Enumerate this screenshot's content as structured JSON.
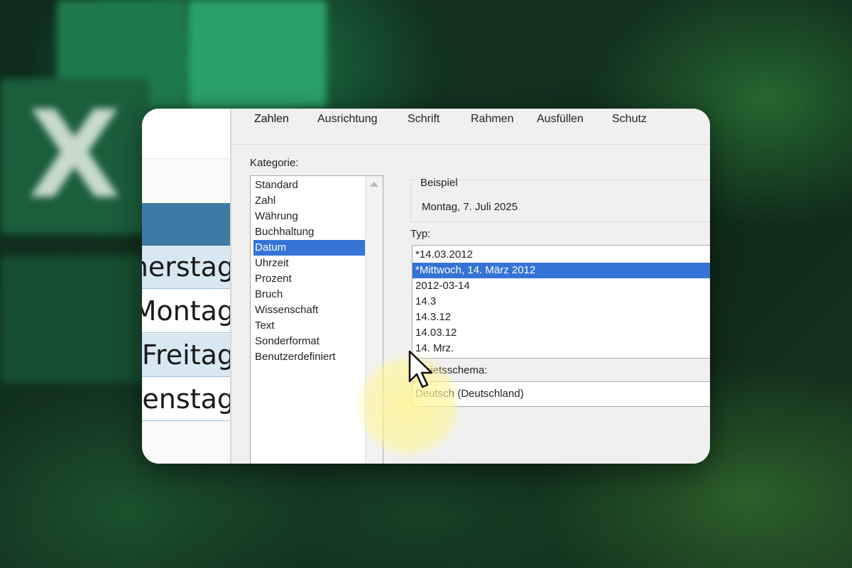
{
  "sheet": {
    "rows": [
      "Donnerstag",
      "Montag",
      "Freitag",
      "Dienstag"
    ]
  },
  "dialog": {
    "tabs": [
      "Zahlen",
      "Ausrichtung",
      "Schrift",
      "Rahmen",
      "Ausfüllen",
      "Schutz"
    ],
    "active_tab": "Zahlen",
    "kategorie_label": "Kategorie:",
    "categories": [
      "Standard",
      "Zahl",
      "Währung",
      "Buchhaltung",
      "Datum",
      "Uhrzeit",
      "Prozent",
      "Bruch",
      "Wissenschaft",
      "Text",
      "Sonderformat",
      "Benutzerdefiniert"
    ],
    "selected_category": "Datum",
    "beispiel_label": "Beispiel",
    "beispiel_value": "Montag, 7. Juli 2025",
    "typ_label": "Typ:",
    "types": [
      "*14.03.2012",
      "*Mittwoch, 14. März 2012",
      "2012-03-14",
      "14.3",
      "14.3.12",
      "14.03.12",
      "14. Mrz."
    ],
    "selected_type": "*Mittwoch, 14. März 2012",
    "gebiet_label": "Gebietsschema:",
    "gebiet_value": "Deutsch (Deutschland)"
  },
  "colors": {
    "selection": "#3574d6",
    "sheet_header": "#3d7aa3",
    "sheet_band": "#d7e8f2"
  }
}
